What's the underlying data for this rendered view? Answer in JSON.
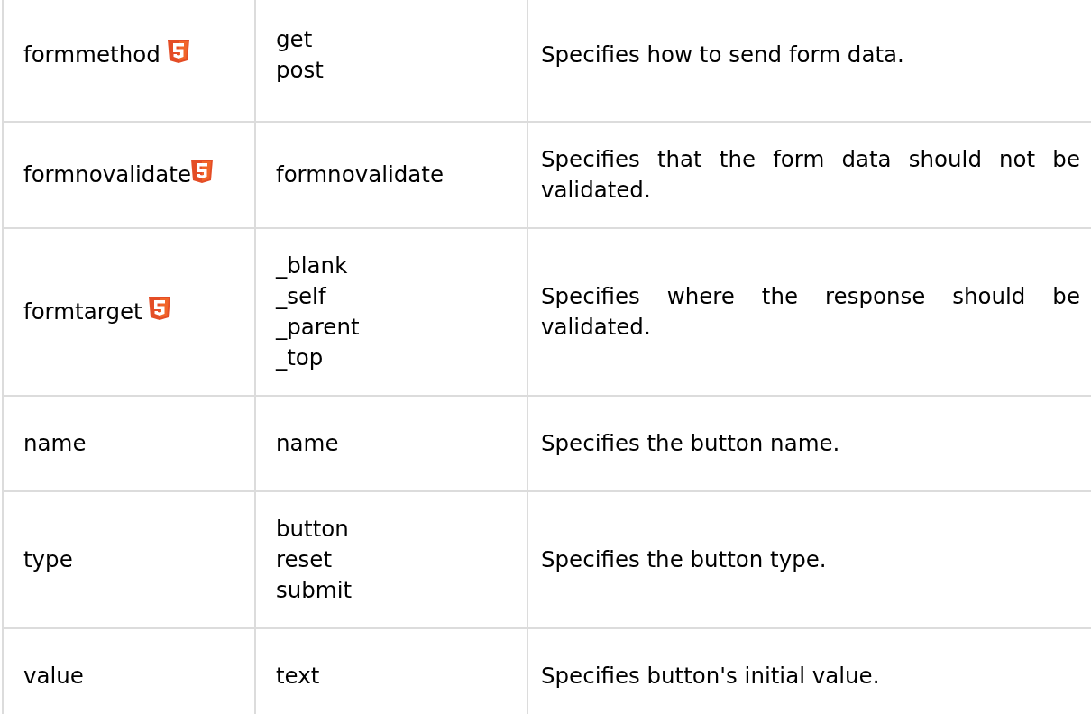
{
  "table": {
    "rows": [
      {
        "attribute": "formmethod",
        "html5_badge": true,
        "values": [
          "get",
          "post"
        ],
        "description": "Specifies how to send form data."
      },
      {
        "attribute": "formnovalidate",
        "html5_badge": true,
        "values": [
          "formnovalidate"
        ],
        "description": "Specifies that the form data should not be validated."
      },
      {
        "attribute": "formtarget",
        "html5_badge": true,
        "values": [
          "_blank",
          "_self",
          "_parent",
          "_top"
        ],
        "description": "Specifies where the response should be validated."
      },
      {
        "attribute": "name",
        "html5_badge": false,
        "values": [
          "name"
        ],
        "description": "Specifies the button name."
      },
      {
        "attribute": "type",
        "html5_badge": false,
        "values": [
          "button",
          "reset",
          "submit"
        ],
        "description": "Specifies the button type."
      },
      {
        "attribute": "value",
        "html5_badge": false,
        "values": [
          "text"
        ],
        "description": "Specifies button's initial value."
      }
    ]
  }
}
